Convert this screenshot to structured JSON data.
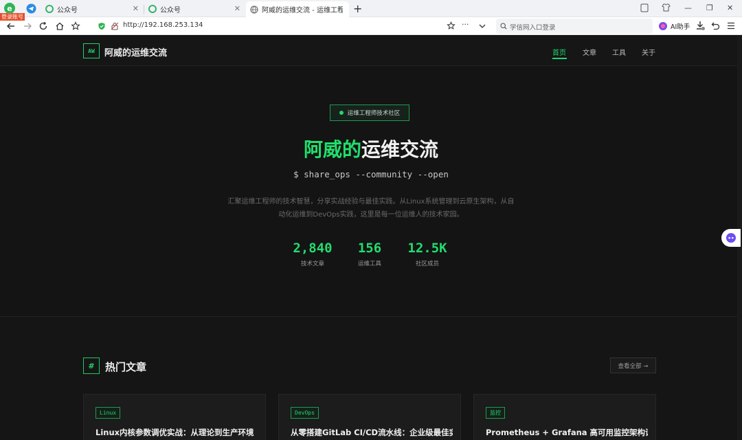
{
  "browser": {
    "login_badge": "登录账号",
    "tabs": [
      {
        "label": "公众号"
      },
      {
        "label": "公众号"
      },
      {
        "label": "阿威的运维交流 - 运维工程师"
      }
    ],
    "new_tab": "+",
    "url": "http://192.168.253.134",
    "search_placeholder": "学信网入口登录",
    "ai_label": "AI助手",
    "colors": {
      "accent": "#20d46b"
    }
  },
  "site": {
    "logo_text": "AW",
    "name": "阿威的运维交流",
    "nav": [
      {
        "label": "首页",
        "active": true
      },
      {
        "label": "文章"
      },
      {
        "label": "工具"
      },
      {
        "label": "关于"
      }
    ]
  },
  "hero": {
    "badge": "运维工程师技术社区",
    "title_highlight": "阿威的",
    "title_rest": "运维交流",
    "command": "$ share_ops --community --open",
    "description": "汇聚运维工程师的技术智慧，分享实战经验与最佳实践。从Linux系统管理到云原生架构，从自动化运维到DevOps实践，这里是每一位运维人的技术家园。",
    "stats": [
      {
        "value": "2,840",
        "label": "技术文章"
      },
      {
        "value": "156",
        "label": "运维工具"
      },
      {
        "value": "12.5K",
        "label": "社区成员"
      }
    ]
  },
  "section": {
    "icon": "#",
    "title": "热门文章",
    "view_all": "查看全部 →"
  },
  "articles": [
    {
      "tag": "Linux",
      "title": "Linux内核参数调优实战：从理论到生产环境"
    },
    {
      "tag": "DevOps",
      "title": "从零搭建GitLab CI/CD流水线：企业级最佳实践"
    },
    {
      "tag": "监控",
      "title": "Prometheus + Grafana 高可用监控架构设计与部署"
    }
  ]
}
